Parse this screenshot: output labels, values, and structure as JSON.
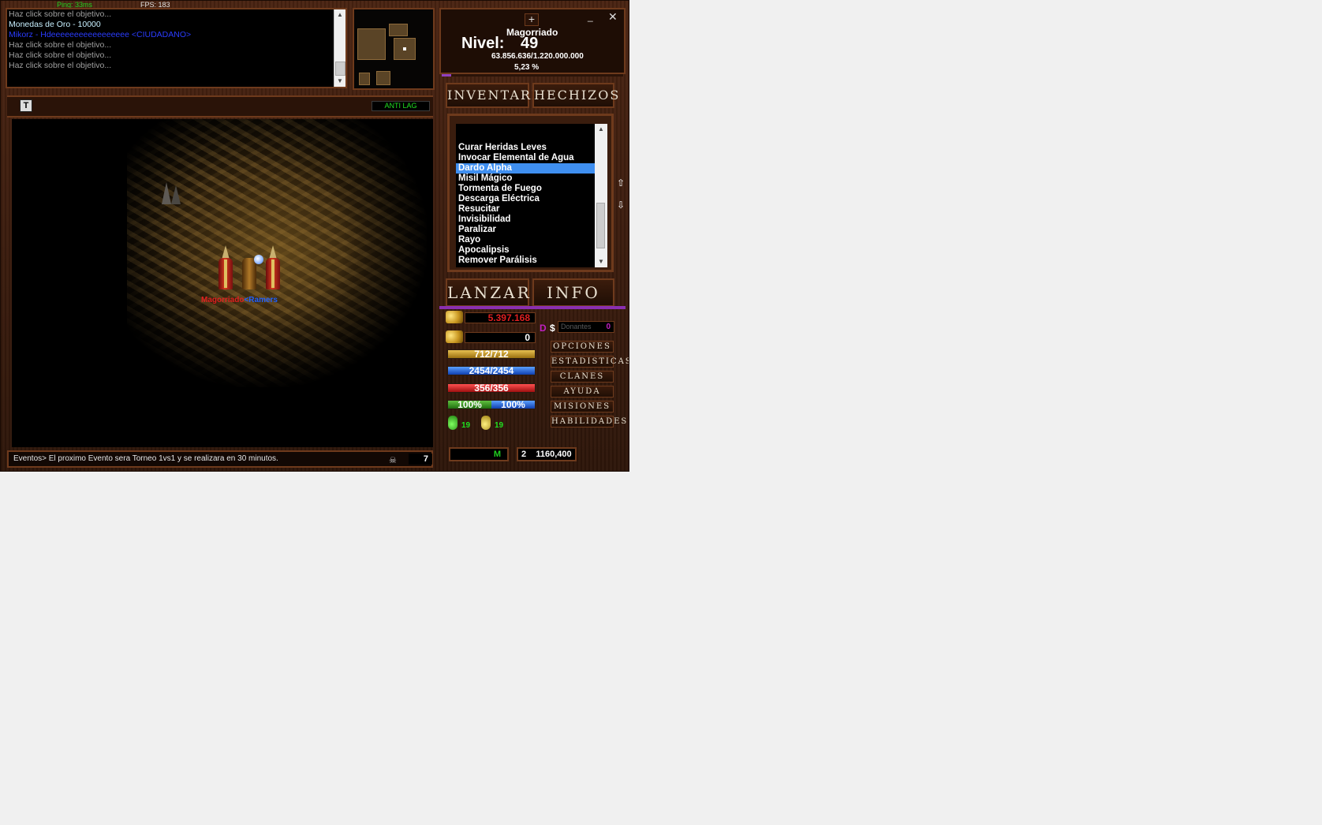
{
  "hud": {
    "ping": "Ping: 33ms",
    "fps": "FPS: 183"
  },
  "console": {
    "lines": [
      {
        "text": "Haz click sobre el objetivo...",
        "color": "#a0a0a0"
      },
      {
        "text": "Monedas de Oro - 10000",
        "color": "#c8f0ff"
      },
      {
        "text": "Mikorz - Hdeeeeeeeeeeeeeeeee <CIUDADANO>",
        "color": "#2a3cff"
      },
      {
        "text": "Haz click sobre el objetivo...",
        "color": "#a0a0a0"
      },
      {
        "text": "Haz click sobre el objetivo...",
        "color": "#a0a0a0"
      },
      {
        "text": "Haz click sobre el objetivo...",
        "color": "#a0a0a0"
      }
    ]
  },
  "toolbar": {
    "t_button": "T",
    "antilag": "ANTI LAG"
  },
  "viewport": {
    "character_name_red": "Magorriado",
    "character_name_blue": "<Ramers"
  },
  "statusbar": {
    "message": "Eventos> El proximo Evento sera Torneo 1vs1 y se realizara en 30 minutos.",
    "count": "7"
  },
  "character": {
    "name": "Magorriado",
    "level_label": "Nivel:",
    "level": "49",
    "exp": "63.856.636/1.220.000.000",
    "exp_percent_text": "5,23 %",
    "exp_fraction": 0.0523
  },
  "tabs": {
    "inventory": "INVENTARIO",
    "spells": "HECHIZOS"
  },
  "spells": {
    "items": [
      "Curar Heridas Leves",
      "Invocar Elemental de Agua",
      "Dardo Alpha",
      "Misil Mágico",
      "Tormenta de Fuego",
      "Descarga Eléctrica",
      "Resucitar",
      "Invisibilidad",
      "Paralizar",
      "Rayo",
      "Apocalipsis",
      "Remover Parálisis"
    ],
    "selected": "Dardo Alpha"
  },
  "actions": {
    "cast": "LANZAR",
    "info": "INFO"
  },
  "gold": {
    "wallet": "5.397.168",
    "bank": "0"
  },
  "donations": {
    "d": "D",
    "s": "$",
    "placeholder": "Donantes",
    "value": "0"
  },
  "stats": {
    "stamina": {
      "text": "712/712",
      "fraction": 1.0
    },
    "mana": {
      "text": "2454/2454",
      "fraction": 1.0
    },
    "health": {
      "text": "356/356",
      "fraction": 1.0
    },
    "hunger": "100%",
    "thirst": "100%"
  },
  "menu": [
    "OPCIONES",
    "ESTADISTICAS",
    "CLANES",
    "AYUDA",
    "MISIONES",
    "HABILIDADES"
  ],
  "potions": {
    "green": "19",
    "yellow": "19"
  },
  "bottom": {
    "map_letter": "M",
    "coords": "2    1160,400"
  },
  "colors": {
    "frame": "#6e3a1c",
    "selection": "#3f8ff0",
    "gold": "#e02020",
    "exp_bar": "#9040c0"
  }
}
